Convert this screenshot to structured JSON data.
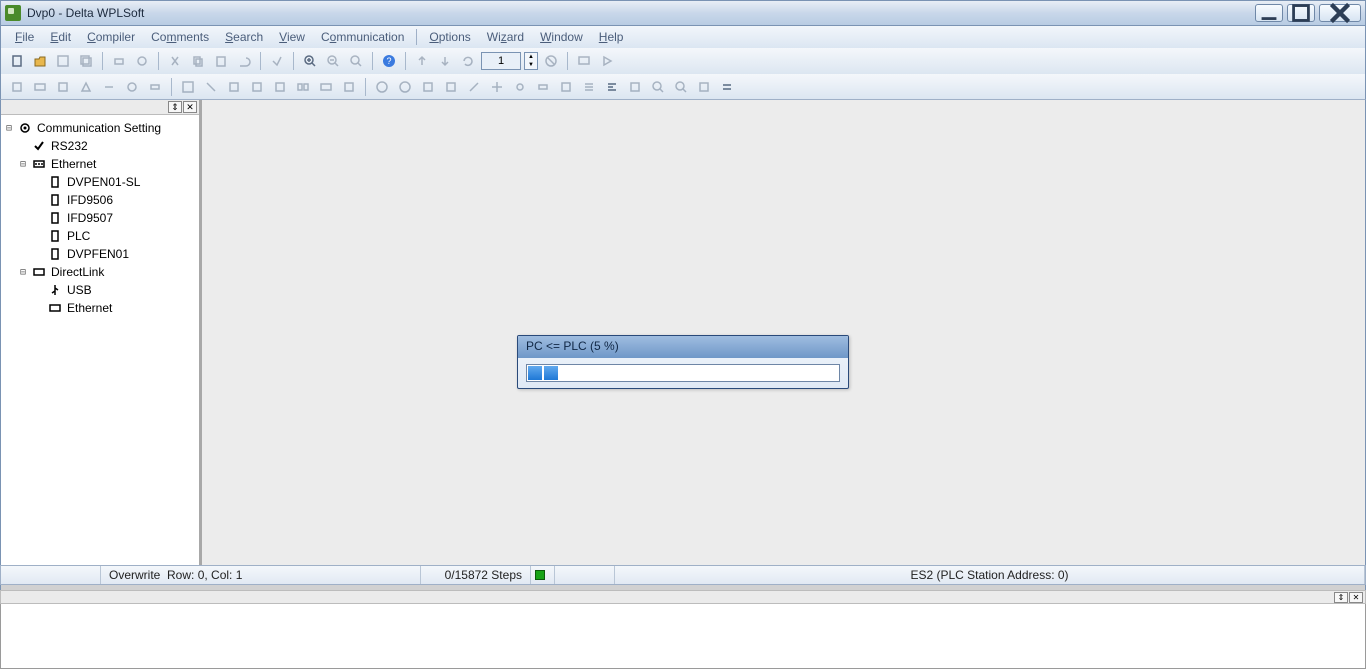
{
  "title": "Dvp0 - Delta WPLSoft",
  "menus": [
    "File",
    "Edit",
    "Compiler",
    "Comments",
    "Search",
    "View",
    "Communication",
    "Options",
    "Wizard",
    "Window",
    "Help"
  ],
  "toolbar1_value": "1",
  "tree": {
    "root": "Communication Setting",
    "rs232": "RS232",
    "ethernet": "Ethernet",
    "eth_children": [
      "DVPEN01-SL",
      "IFD9506",
      "IFD9507",
      "PLC",
      "DVPFEN01"
    ],
    "directlink": "DirectLink",
    "dl_children": [
      "USB",
      "Ethernet"
    ]
  },
  "progress": {
    "label": "PC <= PLC (5 %)",
    "percent": 5,
    "chunks": 2
  },
  "status": {
    "overwrite": "Overwrite",
    "rowcol": "Row: 0, Col: 1",
    "steps": "0/15872 Steps",
    "plc": "ES2 (PLC Station Address: 0)"
  }
}
